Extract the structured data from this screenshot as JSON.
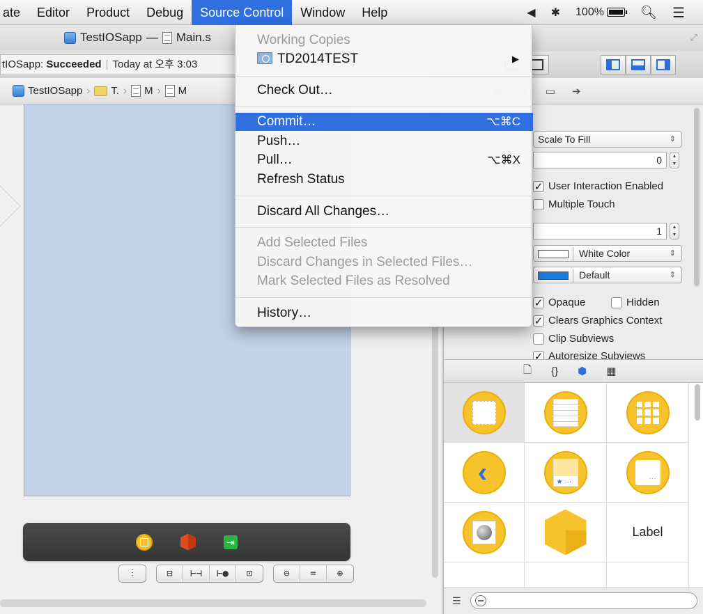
{
  "menubar": {
    "items": [
      "ate",
      "Editor",
      "Product",
      "Debug",
      "Source Control",
      "Window",
      "Help"
    ],
    "active": "Source Control",
    "battery": "100%"
  },
  "window": {
    "project": "TestIOSapp",
    "dash": "—",
    "file": "Main.s"
  },
  "status": {
    "app": "tIOSapp: ",
    "result": "Succeeded",
    "time": "Today at 오후 3:03"
  },
  "jumpbar": {
    "project": "TestIOSapp",
    "c1": "T.",
    "c2": "M",
    "c3": "M"
  },
  "menu": {
    "working_copies": "Working Copies",
    "repo": "TD2014TEST",
    "check_out": "Check Out…",
    "commit": "Commit…",
    "commit_sc": "⌥⌘C",
    "push": "Push…",
    "pull": "Pull…",
    "pull_sc": "⌥⌘X",
    "refresh": "Refresh Status",
    "discard_all": "Discard All Changes…",
    "add_selected": "Add Selected Files",
    "discard_selected": "Discard Changes in Selected Files…",
    "mark_resolved": "Mark Selected Files as Resolved",
    "history": "History…"
  },
  "inspector": {
    "mode_value": "Scale To Fill",
    "tag_value": "0",
    "user_interaction": "User Interaction Enabled",
    "multiple_touch": "Multiple Touch",
    "alpha_value": "1",
    "background_value": "White Color",
    "tint_value": "Default",
    "opaque": "Opaque",
    "hidden": "Hidden",
    "clears_graphics": "Clears Graphics Context",
    "clip_subviews": "Clip Subviews",
    "autoresize": "Autoresize Subviews"
  },
  "library": {
    "label_item": "Label"
  },
  "colors": {
    "accent": "#2f6fe0",
    "canvas_view": "#c2d2e8",
    "object_yellow": "#f7c32c"
  }
}
